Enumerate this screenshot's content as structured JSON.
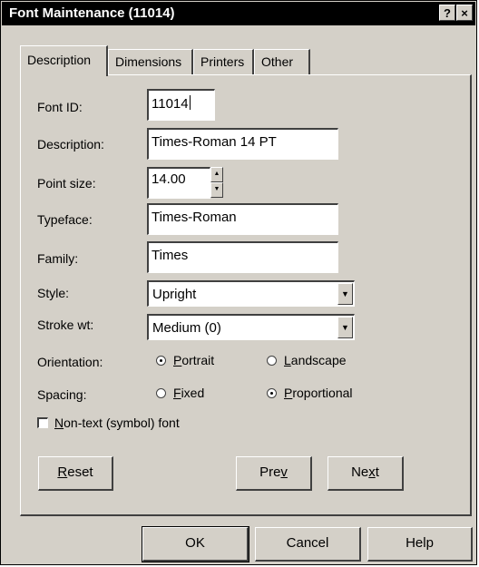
{
  "window": {
    "title": "Font Maintenance (11014)",
    "help_glyph": "?",
    "close_glyph": "×"
  },
  "tabs": [
    {
      "label": "Description",
      "active": true
    },
    {
      "label": "Dimensions",
      "active": false
    },
    {
      "label": "Printers",
      "active": false
    },
    {
      "label": "Other",
      "active": false
    }
  ],
  "form": {
    "font_id": {
      "label": "Font ID:",
      "value": "11014"
    },
    "description": {
      "label": "Description:",
      "value": "Times-Roman 14 PT"
    },
    "point_size": {
      "label": "Point size:",
      "value": "14.00"
    },
    "typeface": {
      "label": "Typeface:",
      "value": "Times-Roman"
    },
    "family": {
      "label": "Family:",
      "value": "Times"
    },
    "style": {
      "label": "Style:",
      "value": "Upright"
    },
    "stroke_wt": {
      "label": "Stroke wt:",
      "value": "Medium (0)"
    },
    "orientation": {
      "label": "Orientation:",
      "options": [
        {
          "pre": "",
          "key": "P",
          "post": "ortrait",
          "selected": true
        },
        {
          "pre": "",
          "key": "L",
          "post": "andscape",
          "selected": false
        }
      ]
    },
    "spacing": {
      "label": "Spacing:",
      "options": [
        {
          "pre": "",
          "key": "F",
          "post": "ixed",
          "selected": false
        },
        {
          "pre": "",
          "key": "P",
          "post": "roportional",
          "selected": true
        }
      ]
    },
    "symbol_font": {
      "pre": "",
      "key": "N",
      "post": "on-text (symbol) font",
      "checked": false
    }
  },
  "panel_buttons": {
    "reset": {
      "pre": "",
      "key": "R",
      "post": "eset"
    },
    "prev": {
      "pre": "Pre",
      "key": "v",
      "post": ""
    },
    "next": {
      "pre": "Ne",
      "key": "x",
      "post": "t"
    }
  },
  "dialog_buttons": {
    "ok": "OK",
    "cancel": "Cancel",
    "help": "Help"
  },
  "colors": {
    "face": "#d4d0c8",
    "titlebar": "#000000",
    "field_bg": "#ffffff"
  }
}
